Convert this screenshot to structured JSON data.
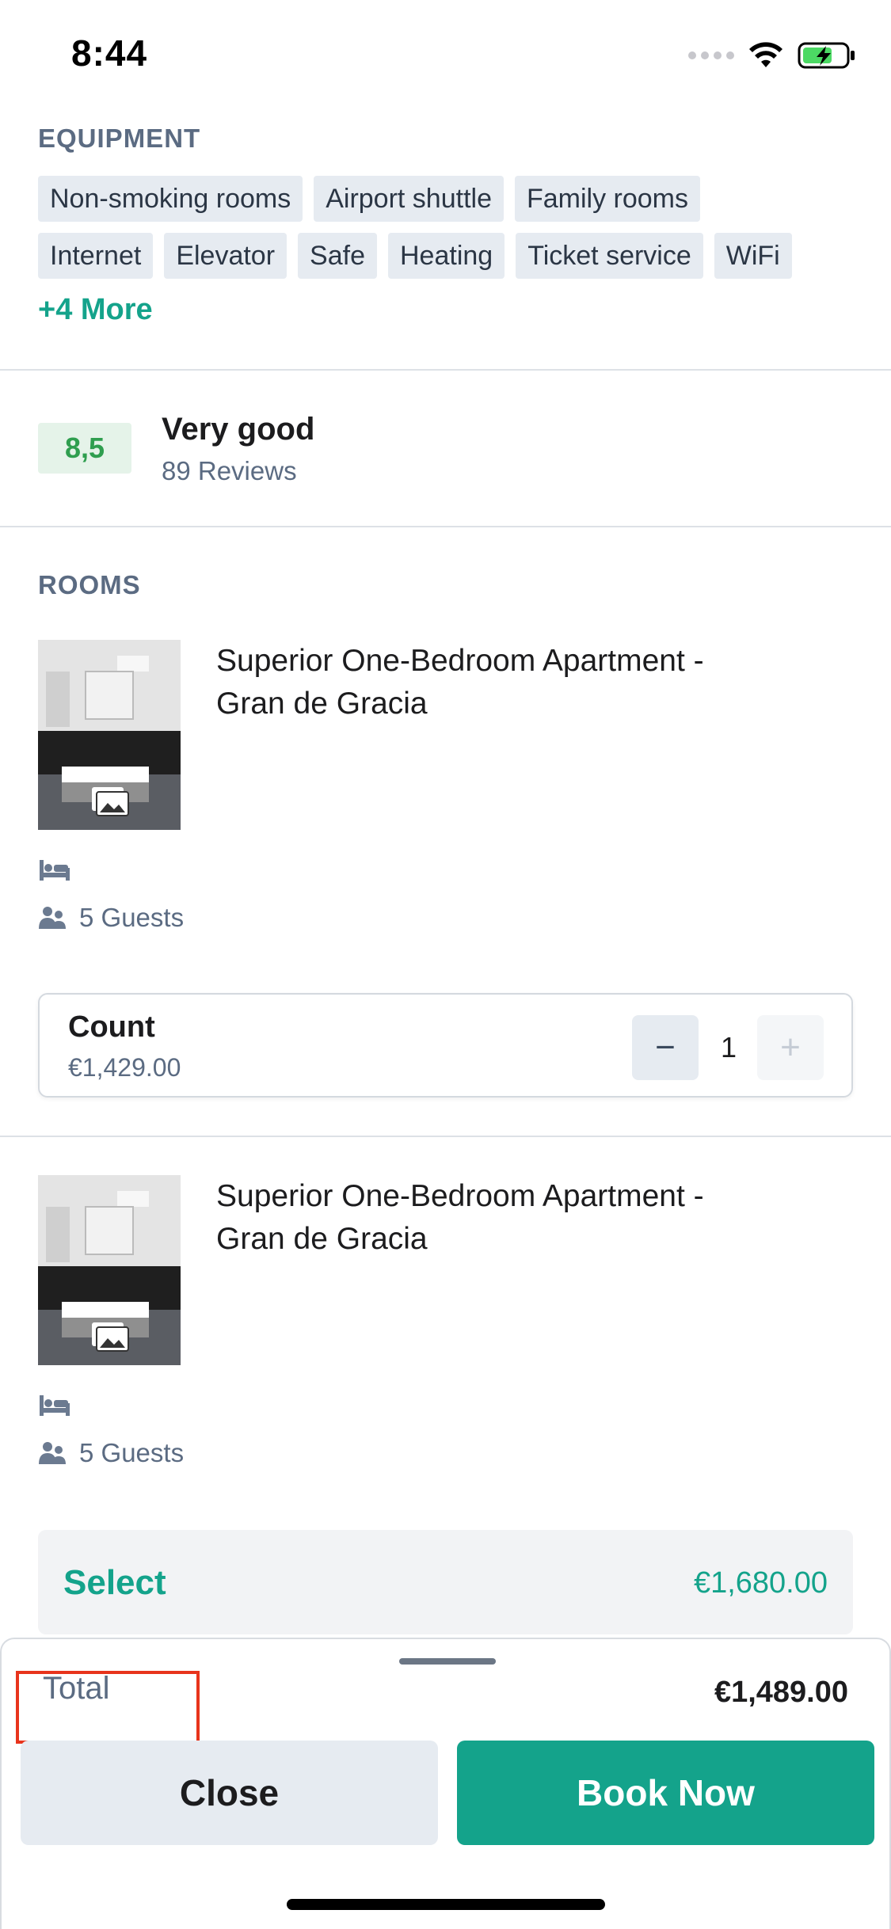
{
  "status_bar": {
    "time": "8:44"
  },
  "equipment": {
    "label": "EQUIPMENT",
    "chips_row1": [
      "Non-smoking rooms",
      "Airport shuttle",
      "Family rooms"
    ],
    "chips_row2": [
      "Internet",
      "Elevator",
      "Safe",
      "Heating",
      "Ticket service",
      "WiFi"
    ],
    "more": "+4 More"
  },
  "rating": {
    "score": "8,5",
    "label": "Very good",
    "reviews": "89 Reviews",
    "score_color": "#2f9e4f"
  },
  "rooms": {
    "label": "ROOMS",
    "items": [
      {
        "title_line1": "Superior One-Bedroom Apartment -",
        "title_line2": "Gran de Gracia",
        "guests": "5 Guests",
        "count_label": "Count",
        "count_price": "€1,429.00",
        "count_value": "1",
        "minus": "−",
        "plus": "+"
      },
      {
        "title_line1": "Superior One-Bedroom Apartment -",
        "title_line2": "Gran de Gracia",
        "guests": "5 Guests",
        "select_label": "Select",
        "select_price": "€1,680.00"
      }
    ]
  },
  "bottom_sheet": {
    "total_label": "Total",
    "total_value": "€1,489.00",
    "close_label": "Close",
    "book_label": "Book Now"
  },
  "colors": {
    "accent": "#14a38b",
    "highlight": "#e8341c",
    "chip_bg": "#e6ebf1",
    "muted_text": "#5b6b82"
  },
  "icons": [
    "wifi-icon",
    "battery-charging-icon",
    "bed-icon",
    "guests-icon",
    "gallery-icon"
  ]
}
